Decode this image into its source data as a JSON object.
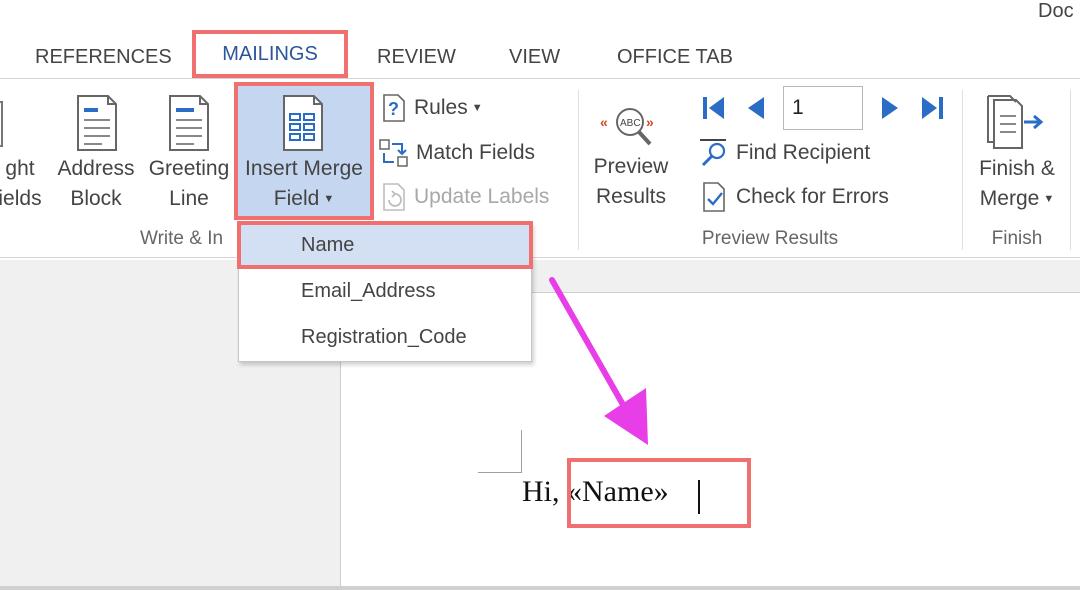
{
  "window": {
    "title": "Doc"
  },
  "tabs": [
    {
      "label": "REFERENCES"
    },
    {
      "label": "MAILINGS"
    },
    {
      "label": "REVIEW"
    },
    {
      "label": "VIEW"
    },
    {
      "label": "OFFICE TAB"
    }
  ],
  "ribbon": {
    "highlight_fields": {
      "line1": "ght",
      "line2": "ields"
    },
    "address_block": {
      "line1": "Address",
      "line2": "Block"
    },
    "greeting_line": {
      "line1": "Greeting",
      "line2": "Line"
    },
    "insert_merge_field": {
      "line1": "Insert Merge",
      "line2": "Field"
    },
    "rules": {
      "label": "Rules"
    },
    "match_fields": {
      "label": "Match Fields"
    },
    "update_labels": {
      "label": "Update Labels"
    },
    "preview_results": {
      "line1": "Preview",
      "line2": "Results"
    },
    "record_number": "1",
    "find_recipient": {
      "label": "Find Recipient"
    },
    "check_errors": {
      "label": "Check for Errors"
    },
    "finish_merge": {
      "line1": "Finish &",
      "line2": "Merge"
    },
    "groups": {
      "write_insert": "Write & In",
      "preview_results": "Preview Results",
      "finish": "Finish"
    }
  },
  "dropdown": {
    "items": [
      {
        "label": "Name"
      },
      {
        "label": "Email_Address"
      },
      {
        "label": "Registration_Code"
      }
    ]
  },
  "document": {
    "prefix": "Hi, ",
    "field": "«Name»"
  },
  "colors": {
    "accent_text": "#2b579a",
    "highlight_border": "#f07070",
    "arrow": "#e83ee8",
    "selected_bg": "#c5d6f0"
  },
  "icons": {
    "first": "first-record-icon",
    "prev": "previous-record-icon",
    "next": "next-record-icon",
    "last": "last-record-icon"
  }
}
